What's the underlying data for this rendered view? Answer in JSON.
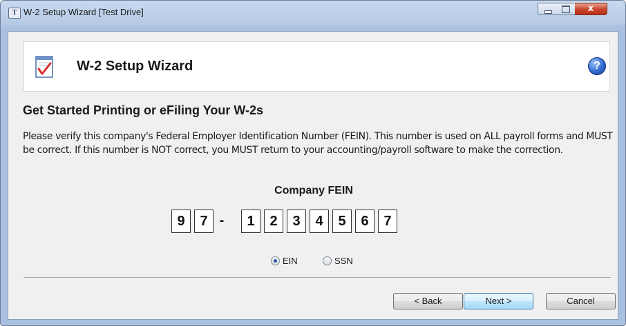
{
  "window": {
    "title": "W-2 Setup Wizard [Test Drive]",
    "app_icon_letter": "T",
    "close_glyph": "x"
  },
  "header": {
    "title": "W-2 Setup Wizard",
    "help_glyph": "?"
  },
  "content": {
    "heading": "Get Started Printing or eFiling Your W-2s",
    "description": "Please verify this company's Federal Employer Identification Number (FEIN). This number is used on ALL payroll forms and MUST be correct. If this number is NOT correct, you MUST return to your accounting/payroll software to make the correction.",
    "fein_label": "Company FEIN",
    "fein_digits": [
      "9",
      "7",
      "1",
      "2",
      "3",
      "4",
      "5",
      "6",
      "7"
    ],
    "fein_separator": "-",
    "id_type": {
      "options": [
        "EIN",
        "SSN"
      ],
      "selected": "EIN"
    }
  },
  "buttons": {
    "back": "< Back",
    "next": "Next >",
    "cancel": "Cancel"
  },
  "icons": {
    "app": "app-icon",
    "wizard": "checklist-icon",
    "help": "help-icon"
  }
}
